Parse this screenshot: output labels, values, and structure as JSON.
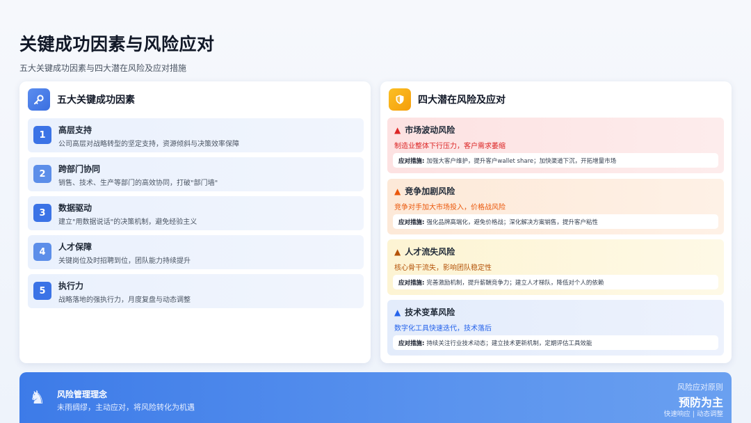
{
  "header": {
    "title": "关键成功因素与风险应对",
    "subtitle": "五大关键成功因素与四大潜在风险及应对措施"
  },
  "left_panel": {
    "icon": "key-icon",
    "title": "五大关键成功因素",
    "factors": [
      {
        "num": "1",
        "name": "高层支持",
        "desc": "公司高层对战略转型的坚定支持，资源倾斜与决策效率保障"
      },
      {
        "num": "2",
        "name": "跨部门协同",
        "desc": "销售、技术、生产等部门的高效协同，打破\"部门墙\""
      },
      {
        "num": "3",
        "name": "数据驱动",
        "desc": "建立\"用数据说话\"的决策机制，避免经验主义"
      },
      {
        "num": "4",
        "name": "人才保障",
        "desc": "关键岗位及时招聘到位，团队能力持续提升"
      },
      {
        "num": "5",
        "name": "执行力",
        "desc": "战略落地的强执行力，月度复盘与动态调整"
      }
    ]
  },
  "right_panel": {
    "icon": "shield-icon",
    "title": "四大潜在风险及应对",
    "measure_label": "应对措施:",
    "risks": [
      {
        "name": "市场波动风险",
        "desc": "制造业整体下行压力，客户需求萎缩",
        "measure": "加强大客户维护，提升客户wallet share；加快渠道下沉，开拓增量市场",
        "color": "#dc2626"
      },
      {
        "name": "竞争加剧风险",
        "desc": "竞争对手加大市场投入，价格战风险",
        "measure": "强化品牌高端化，避免价格战；深化解决方案销售，提升客户粘性",
        "color": "#ea580c"
      },
      {
        "name": "人才流失风险",
        "desc": "核心骨干流失，影响团队稳定性",
        "measure": "完善激励机制，提升薪酬竞争力；建立人才梯队，降低对个人的依赖",
        "color": "#b45309"
      },
      {
        "name": "技术变革风险",
        "desc": "数字化工具快速迭代，技术落后",
        "measure": "持续关注行业技术动态；建立技术更新机制，定期评估工具效能",
        "color": "#2563eb"
      }
    ]
  },
  "footer": {
    "icon": "chess-knight-icon",
    "title": "风险管理理念",
    "subtitle": "未雨绸缪，主动应对，将风险转化为机遇",
    "right_label": "风险应对原则",
    "right_big": "预防为主",
    "right_small": "快速响应 | 动态调整"
  }
}
